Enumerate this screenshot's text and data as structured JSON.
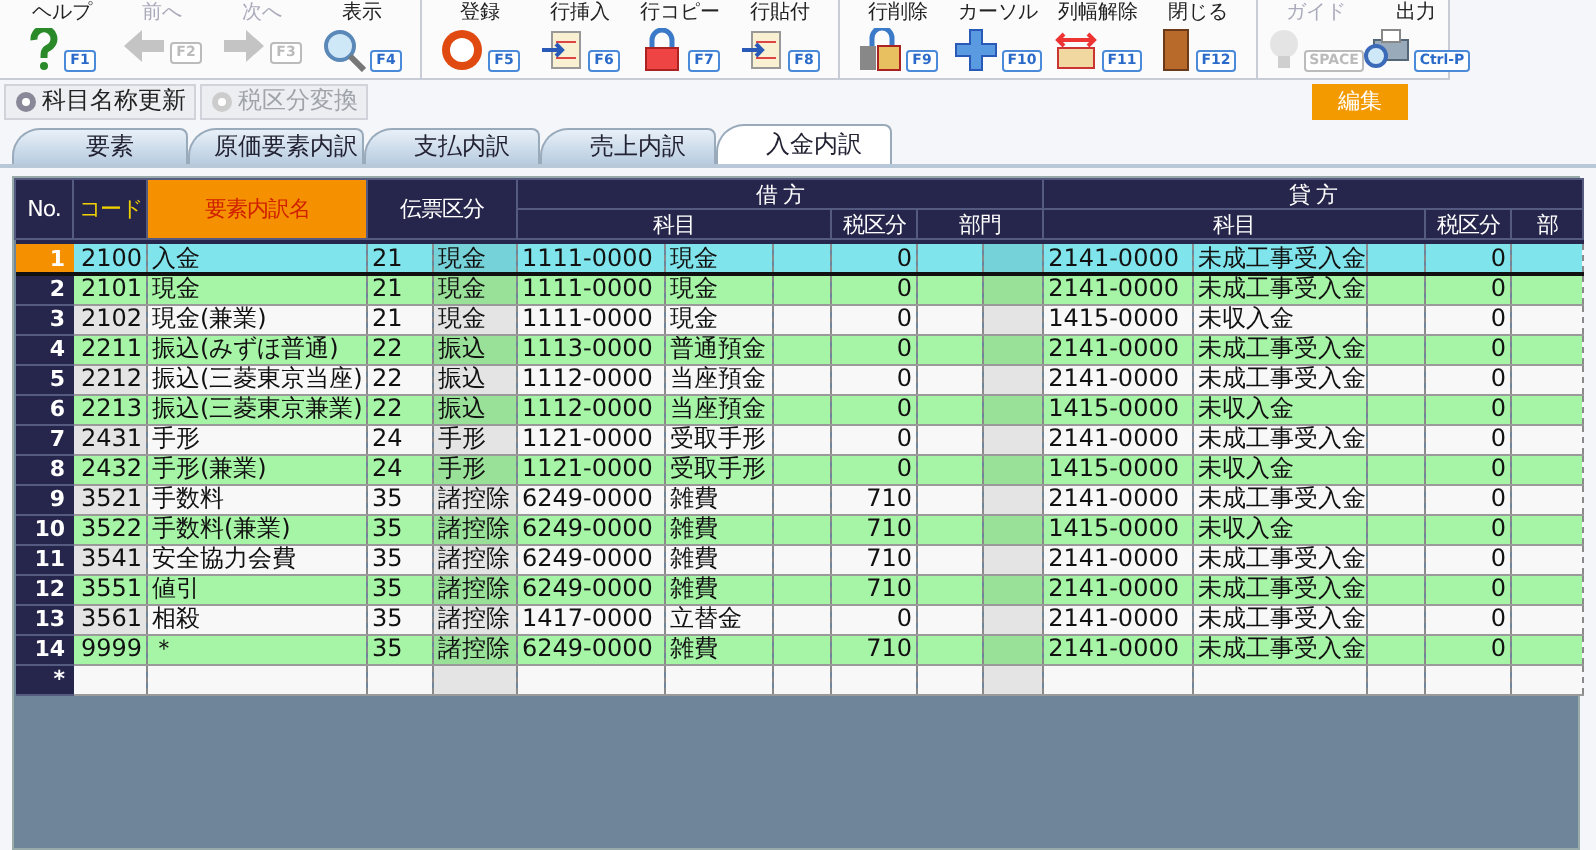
{
  "toolbar": [
    {
      "buttons": [
        {
          "label": "ヘルプ",
          "key": "F1",
          "disabled": false
        },
        {
          "label": "前へ",
          "key": "F2",
          "disabled": true
        },
        {
          "label": "次へ",
          "key": "F3",
          "disabled": true
        },
        {
          "label": "表示",
          "key": "F4",
          "disabled": false
        }
      ]
    },
    {
      "buttons": [
        {
          "label": "登録",
          "key": "F5",
          "disabled": false
        },
        {
          "label": "行挿入",
          "key": "F6",
          "disabled": false
        },
        {
          "label": "行コピー",
          "key": "F7",
          "disabled": false
        },
        {
          "label": "行貼付",
          "key": "F8",
          "disabled": false
        }
      ]
    },
    {
      "buttons": [
        {
          "label": "行削除",
          "key": "F9",
          "disabled": false
        },
        {
          "label": "カーソル",
          "key": "F10",
          "disabled": false
        },
        {
          "label": "列幅解除",
          "key": "F11",
          "disabled": false
        },
        {
          "label": "閉じる",
          "key": "F12",
          "disabled": false
        }
      ]
    },
    {
      "buttons": [
        {
          "label": "ガイド",
          "key": "SPACE",
          "disabled": true
        },
        {
          "label": "出力",
          "key": "Ctrl-P",
          "disabled": false
        }
      ]
    }
  ],
  "actions": [
    {
      "label": "科目名称更新",
      "disabled": false
    },
    {
      "label": "税区分変換",
      "disabled": true
    }
  ],
  "mode_badge": "編集",
  "tabs": [
    {
      "label": "要素",
      "selected": false
    },
    {
      "label": "原価要素内訳",
      "selected": false
    },
    {
      "label": "支払内訳",
      "selected": false
    },
    {
      "label": "売上内訳",
      "selected": false
    },
    {
      "label": "入金内訳",
      "selected": true
    }
  ],
  "grid": {
    "no_label": "No.",
    "columns": [
      {
        "label": "コード",
        "kind": "key"
      },
      {
        "label": "要素内訳名",
        "kind": "focus"
      },
      {
        "label": "伝票区分",
        "kind": "plain"
      }
    ],
    "debit": {
      "label": "借 方",
      "account": "科目",
      "tax": "税区分",
      "dept": "部門"
    },
    "credit": {
      "label": "貸 方",
      "account": "科目",
      "tax": "税区分",
      "dept": "部"
    },
    "rows": [
      {
        "no": "1",
        "code": "2100",
        "name": "入金",
        "slip_code": "21",
        "slip_name": "現金",
        "debit_code": "1111-0000",
        "debit_account": "現金",
        "debit_tax": "0",
        "credit_code": "2141-0000",
        "credit_account": "未成工事受入金",
        "credit_tax": "0",
        "selected": true
      },
      {
        "no": "2",
        "code": "2101",
        "name": "現金",
        "slip_code": "21",
        "slip_name": "現金",
        "debit_code": "1111-0000",
        "debit_account": "現金",
        "debit_tax": "0",
        "credit_code": "2141-0000",
        "credit_account": "未成工事受入金",
        "credit_tax": "0",
        "selected": false
      },
      {
        "no": "3",
        "code": "2102",
        "name": "現金(兼業)",
        "slip_code": "21",
        "slip_name": "現金",
        "debit_code": "1111-0000",
        "debit_account": "現金",
        "debit_tax": "0",
        "credit_code": "1415-0000",
        "credit_account": "未収入金",
        "credit_tax": "0",
        "selected": false
      },
      {
        "no": "4",
        "code": "2211",
        "name": "振込(みずほ普通)",
        "slip_code": "22",
        "slip_name": "振込",
        "debit_code": "1113-0000",
        "debit_account": "普通預金",
        "debit_tax": "0",
        "credit_code": "2141-0000",
        "credit_account": "未成工事受入金",
        "credit_tax": "0",
        "selected": false
      },
      {
        "no": "5",
        "code": "2212",
        "name": "振込(三菱東京当座)",
        "slip_code": "22",
        "slip_name": "振込",
        "debit_code": "1112-0000",
        "debit_account": "当座預金",
        "debit_tax": "0",
        "credit_code": "2141-0000",
        "credit_account": "未成工事受入金",
        "credit_tax": "0",
        "selected": false
      },
      {
        "no": "6",
        "code": "2213",
        "name": "振込(三菱東京兼業)",
        "slip_code": "22",
        "slip_name": "振込",
        "debit_code": "1112-0000",
        "debit_account": "当座預金",
        "debit_tax": "0",
        "credit_code": "1415-0000",
        "credit_account": "未収入金",
        "credit_tax": "0",
        "selected": false
      },
      {
        "no": "7",
        "code": "2431",
        "name": "手形",
        "slip_code": "24",
        "slip_name": "手形",
        "debit_code": "1121-0000",
        "debit_account": "受取手形",
        "debit_tax": "0",
        "credit_code": "2141-0000",
        "credit_account": "未成工事受入金",
        "credit_tax": "0",
        "selected": false
      },
      {
        "no": "8",
        "code": "2432",
        "name": "手形(兼業)",
        "slip_code": "24",
        "slip_name": "手形",
        "debit_code": "1121-0000",
        "debit_account": "受取手形",
        "debit_tax": "0",
        "credit_code": "1415-0000",
        "credit_account": "未収入金",
        "credit_tax": "0",
        "selected": false
      },
      {
        "no": "9",
        "code": "3521",
        "name": "手数料",
        "slip_code": "35",
        "slip_name": "諸控除",
        "debit_code": "6249-0000",
        "debit_account": "雑費",
        "debit_tax": "710",
        "credit_code": "2141-0000",
        "credit_account": "未成工事受入金",
        "credit_tax": "0",
        "selected": false
      },
      {
        "no": "10",
        "code": "3522",
        "name": "手数料(兼業)",
        "slip_code": "35",
        "slip_name": "諸控除",
        "debit_code": "6249-0000",
        "debit_account": "雑費",
        "debit_tax": "710",
        "credit_code": "1415-0000",
        "credit_account": "未収入金",
        "credit_tax": "0",
        "selected": false
      },
      {
        "no": "11",
        "code": "3541",
        "name": "安全協力会費",
        "slip_code": "35",
        "slip_name": "諸控除",
        "debit_code": "6249-0000",
        "debit_account": "雑費",
        "debit_tax": "710",
        "credit_code": "2141-0000",
        "credit_account": "未成工事受入金",
        "credit_tax": "0",
        "selected": false
      },
      {
        "no": "12",
        "code": "3551",
        "name": "値引",
        "slip_code": "35",
        "slip_name": "諸控除",
        "debit_code": "6249-0000",
        "debit_account": "雑費",
        "debit_tax": "710",
        "credit_code": "2141-0000",
        "credit_account": "未成工事受入金",
        "credit_tax": "0",
        "selected": false
      },
      {
        "no": "13",
        "code": "3561",
        "name": "相殺",
        "slip_code": "35",
        "slip_name": "諸控除",
        "debit_code": "1417-0000",
        "debit_account": "立替金",
        "debit_tax": "0",
        "credit_code": "2141-0000",
        "credit_account": "未成工事受入金",
        "credit_tax": "0",
        "selected": false
      },
      {
        "no": "14",
        "code": "9999",
        "name": "＊",
        "slip_code": "35",
        "slip_name": "諸控除",
        "debit_code": "6249-0000",
        "debit_account": "雑費",
        "debit_tax": "710",
        "credit_code": "2141-0000",
        "credit_account": "未成工事受入金",
        "credit_tax": "0",
        "selected": false
      }
    ],
    "new_row_marker": "*"
  }
}
